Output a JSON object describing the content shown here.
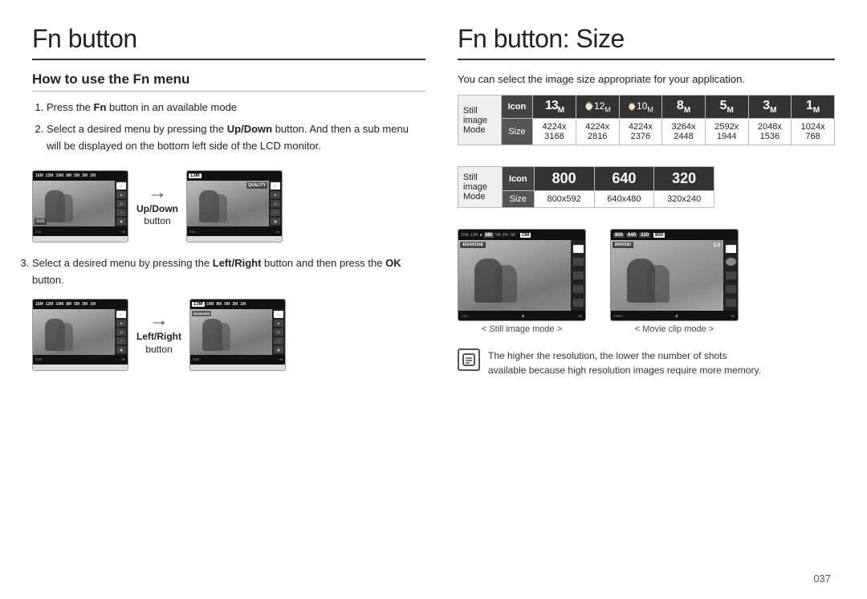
{
  "left": {
    "title": "Fn button",
    "subsection": "How to use the Fn menu",
    "step1": "Press the ",
    "step1_bold": "Fn",
    "step1_rest": " button in an available mode",
    "step2": "Select a desired menu by pressing the ",
    "step2_bold": "Up/Down",
    "step2_rest": " button. And then a sub menu will be displayed on the bottom left side of the LCD monitor.",
    "updown_label_line1": "Up/Down",
    "updown_label_line2": "button",
    "step3_pre": "Select a desired menu by pressing the ",
    "step3_bold": "Left/Right",
    "step3_rest": " button and then press the ",
    "step3_ok": "OK",
    "step3_end": " button.",
    "leftright_label_line1": "Left/Right",
    "leftright_label_line2": "button"
  },
  "right": {
    "title": "Fn button: Size",
    "intro": "You can select the image size appropriate for your application.",
    "table1": {
      "headers": [
        "Still image Mode",
        "Icon",
        "13M",
        "12M",
        "10M",
        "8M",
        "5M",
        "3M",
        "1M"
      ],
      "row_size_label": "Size",
      "sizes": [
        "4224x 3168",
        "4224x 2816",
        "4224x 2376",
        "3264x 2448",
        "2592x 1944",
        "2048x 1536",
        "1024x 768"
      ]
    },
    "table2": {
      "headers_bold": [
        "800",
        "640",
        "320"
      ],
      "row_size_label": "Size",
      "sizes": [
        "800x592",
        "640x480",
        "320x240"
      ]
    },
    "caption_still": "< Still image mode >",
    "caption_movie": "< Movie clip mode >",
    "note_line1": "The higher the resolution, the lower the number of shots",
    "note_line2": "available because high resolution images require more memory."
  },
  "page_number": "037"
}
